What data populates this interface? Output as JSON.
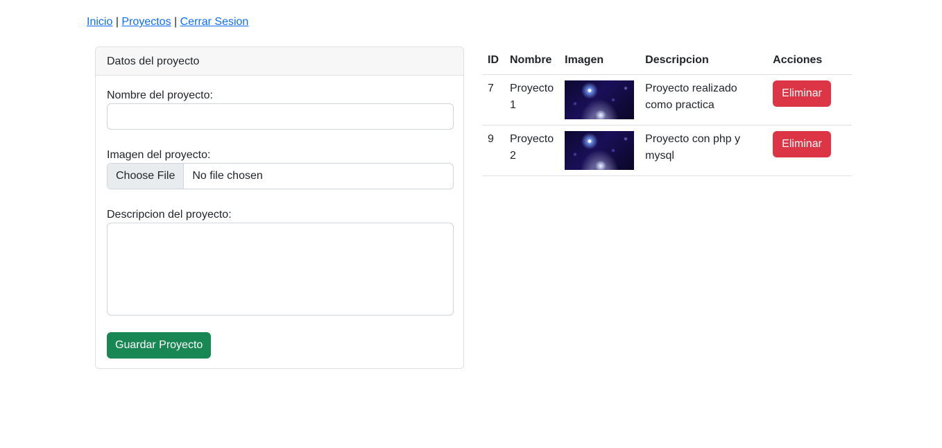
{
  "nav": {
    "links": [
      "Inicio",
      "Proyectos",
      "Cerrar Sesion"
    ],
    "separator": "|"
  },
  "form": {
    "header": "Datos del proyecto",
    "name_label": "Nombre del proyecto:",
    "name_value": "",
    "image_label": "Imagen del proyecto:",
    "file_button": "Choose File",
    "file_status": "No file chosen",
    "description_label": "Descripcion del proyecto:",
    "description_value": "",
    "submit_label": "Guardar Proyecto"
  },
  "table": {
    "headers": [
      "ID",
      "Nombre",
      "Imagen",
      "Descripcion",
      "Acciones"
    ],
    "rows": [
      {
        "id": "7",
        "name": "Proyecto 1",
        "description": "Proyecto realizado como practica",
        "action": "Eliminar"
      },
      {
        "id": "9",
        "name": "Proyecto 2",
        "description": "Proyecto con php y mysql",
        "action": "Eliminar"
      }
    ]
  },
  "colors": {
    "link": "#0d6efd",
    "success": "#198754",
    "danger": "#dc3545"
  }
}
